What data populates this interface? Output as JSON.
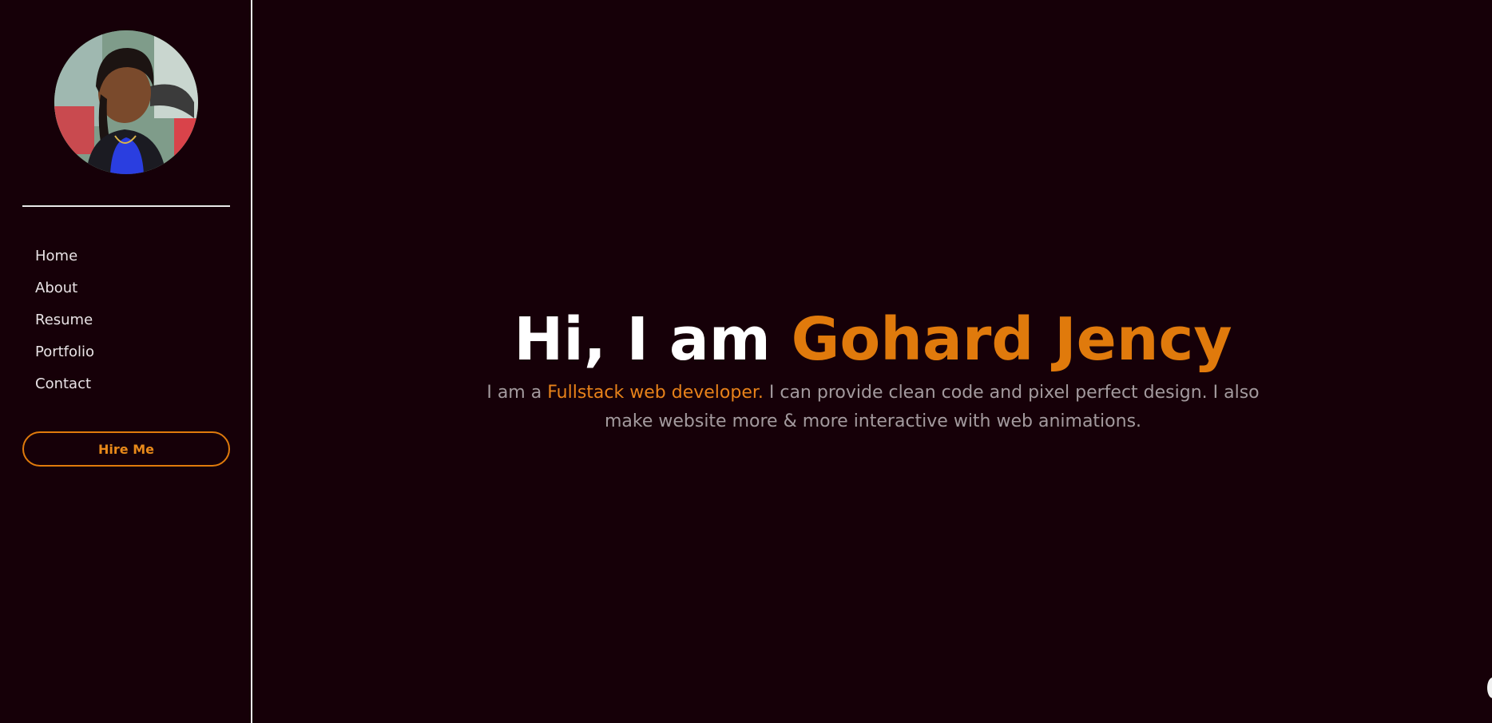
{
  "profile": {
    "avatar_alt": "profile photo"
  },
  "nav": {
    "items": [
      {
        "label": "Home"
      },
      {
        "label": "About"
      },
      {
        "label": "Resume"
      },
      {
        "label": "Portfolio"
      },
      {
        "label": "Contact"
      }
    ]
  },
  "sidebar": {
    "hire_button_label": "Hire Me"
  },
  "hero": {
    "greeting": "Hi, I am ",
    "name": "Gohard Jency",
    "intro_prefix": "I am a ",
    "intro_highlight": "Fullstack web developer.",
    "intro_rest": " I can provide clean code and pixel perfect design. I also make website more & more interactive with web animations."
  },
  "colors": {
    "background": "#160008",
    "accent": "#e07a0c",
    "text_muted": "#a39a9e",
    "divider": "#e8e8e8"
  }
}
